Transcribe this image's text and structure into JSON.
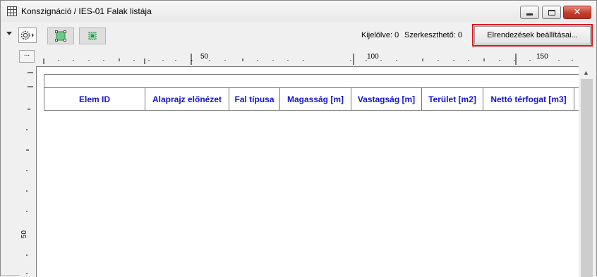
{
  "window": {
    "title": "Konszignáció / IES-01 Falak listája"
  },
  "toolbar": {
    "selected_status": "Kijelölve: 0",
    "editable_status": "Szerkeszthető: 0",
    "layout_settings_label": "Elrendezések beállításai...",
    "more_label": "..."
  },
  "rulers": {
    "horizontal_labels": [
      "50",
      "100",
      "150"
    ],
    "vertical_labels": [
      "50"
    ]
  },
  "table": {
    "columns": [
      "Elem ID",
      "Alaprajz előnézet",
      "Fal típusa",
      "Magasság [m]",
      "Vastagság [m]",
      "Terület [m2]",
      "Nettó térfogat [m3]"
    ]
  },
  "colors": {
    "header_text": "#1414d2",
    "highlight_frame": "#e0141e",
    "close_button": "#c23d2a"
  }
}
